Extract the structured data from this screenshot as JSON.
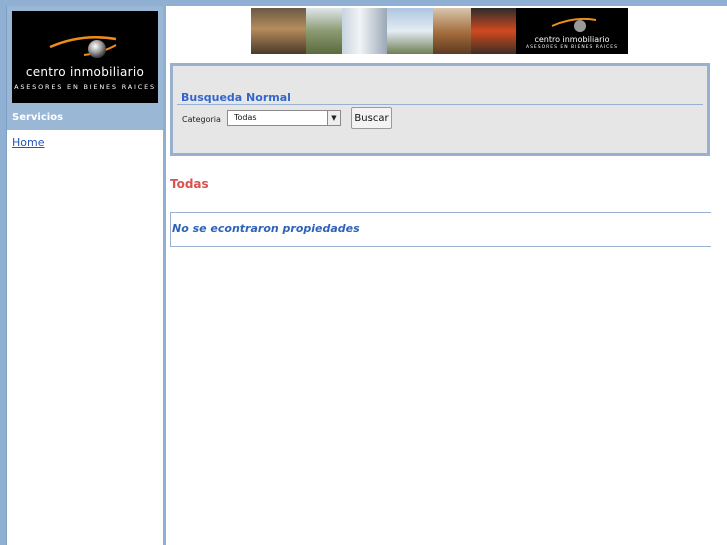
{
  "sidebar": {
    "logo": {
      "line1": "centro inmobiliario",
      "line2": "ASESORES EN BIENES RAICES"
    },
    "section_title": "Servicios",
    "links": [
      {
        "label": "Home"
      }
    ]
  },
  "banner": {
    "logo": {
      "line1": "centro inmobiliario",
      "line2": "ASESORES EN BIENES RAICES"
    }
  },
  "search": {
    "legend": "Busqueda Normal",
    "category_label": "Categoria",
    "category_selected": "Todas",
    "submit_label": "Buscar"
  },
  "results": {
    "title": "Todas",
    "empty_message": "No se econtraron propiedades"
  },
  "colors": {
    "page_background": "#8fb0d2",
    "accent_blue": "#3366cc",
    "title_red": "#d9534f"
  }
}
